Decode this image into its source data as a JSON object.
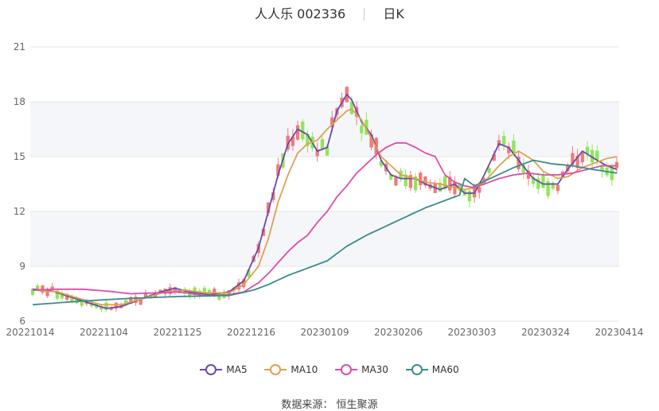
{
  "header": {
    "stock": "人人乐 002336",
    "period": "日K"
  },
  "legend": [
    {
      "name": "MA5",
      "color": "#6b4ba8"
    },
    {
      "name": "MA10",
      "color": "#e0a050"
    },
    {
      "name": "MA30",
      "color": "#d94fa8"
    },
    {
      "name": "MA60",
      "color": "#3a8c8c"
    }
  ],
  "source": "数据来源： 恒生聚源",
  "colors": {
    "up": "#f07a7a",
    "down": "#8ee65a"
  },
  "chart_data": {
    "type": "candlestick",
    "ylim": [
      6,
      21
    ],
    "yticks": [
      "6",
      "9",
      "12",
      "15",
      "18",
      "21"
    ],
    "xticks": [
      "20221014",
      "20221104",
      "20221125",
      "20221216",
      "20230109",
      "20230206",
      "20230303",
      "20230324",
      "20230414"
    ],
    "num_bars": 120,
    "series": [
      {
        "name": "MA5",
        "anchors": [
          [
            0,
            7.75
          ],
          [
            4,
            7.65
          ],
          [
            8,
            7.3
          ],
          [
            12,
            6.95
          ],
          [
            15,
            6.7
          ],
          [
            18,
            6.8
          ],
          [
            22,
            7.2
          ],
          [
            26,
            7.6
          ],
          [
            29,
            7.8
          ],
          [
            32,
            7.6
          ],
          [
            36,
            7.45
          ],
          [
            40,
            7.6
          ],
          [
            43,
            8.2
          ],
          [
            46,
            10
          ],
          [
            48,
            12
          ],
          [
            50,
            14
          ],
          [
            52,
            15.7
          ],
          [
            54,
            16.5
          ],
          [
            56,
            16.2
          ],
          [
            58,
            15.3
          ],
          [
            60,
            15.5
          ],
          [
            62,
            17.5
          ],
          [
            64,
            18.4
          ],
          [
            65,
            18.1
          ],
          [
            67,
            16.9
          ],
          [
            69,
            16.2
          ],
          [
            71,
            14.8
          ],
          [
            73,
            14
          ],
          [
            75,
            13.8
          ],
          [
            78,
            13.8
          ],
          [
            80,
            13.5
          ],
          [
            83,
            13.2
          ],
          [
            86,
            13.5
          ],
          [
            88,
            13
          ],
          [
            90,
            13
          ],
          [
            92,
            14
          ],
          [
            95,
            15.7
          ],
          [
            97,
            15.5
          ],
          [
            99,
            14.8
          ],
          [
            102,
            13.8
          ],
          [
            104,
            13.5
          ],
          [
            107,
            13.5
          ],
          [
            109,
            14.3
          ],
          [
            112,
            15.3
          ],
          [
            115,
            14.8
          ],
          [
            117,
            14.5
          ],
          [
            119,
            14.3
          ]
        ]
      },
      {
        "name": "MA10",
        "anchors": [
          [
            0,
            7.7
          ],
          [
            5,
            7.6
          ],
          [
            10,
            7.2
          ],
          [
            14,
            6.9
          ],
          [
            18,
            6.9
          ],
          [
            22,
            7.2
          ],
          [
            27,
            7.6
          ],
          [
            31,
            7.7
          ],
          [
            35,
            7.55
          ],
          [
            40,
            7.55
          ],
          [
            43,
            8.0
          ],
          [
            46,
            9
          ],
          [
            48,
            10.5
          ],
          [
            50,
            12.5
          ],
          [
            52,
            14
          ],
          [
            54,
            15.2
          ],
          [
            56,
            15.7
          ],
          [
            58,
            15.9
          ],
          [
            60,
            16.5
          ],
          [
            62,
            17
          ],
          [
            64,
            17.5
          ],
          [
            65,
            17.6
          ],
          [
            67,
            17
          ],
          [
            69,
            16
          ],
          [
            71,
            15
          ],
          [
            73,
            14.5
          ],
          [
            75,
            14
          ],
          [
            78,
            13.8
          ],
          [
            80,
            13.6
          ],
          [
            83,
            13.5
          ],
          [
            86,
            13.3
          ],
          [
            88,
            13.2
          ],
          [
            90,
            13.3
          ],
          [
            92,
            13.6
          ],
          [
            95,
            14.5
          ],
          [
            97,
            15
          ],
          [
            99,
            15.3
          ],
          [
            102,
            14.8
          ],
          [
            104,
            14.2
          ],
          [
            107,
            13.8
          ],
          [
            109,
            13.9
          ],
          [
            112,
            14.4
          ],
          [
            115,
            14.7
          ],
          [
            117,
            14.9
          ],
          [
            119,
            15
          ]
        ]
      },
      {
        "name": "MA30",
        "anchors": [
          [
            0,
            7.7
          ],
          [
            5,
            7.75
          ],
          [
            10,
            7.75
          ],
          [
            15,
            7.65
          ],
          [
            20,
            7.5
          ],
          [
            25,
            7.55
          ],
          [
            30,
            7.6
          ],
          [
            35,
            7.4
          ],
          [
            40,
            7.45
          ],
          [
            43,
            7.6
          ],
          [
            46,
            8.1
          ],
          [
            48,
            8.6
          ],
          [
            50,
            9.2
          ],
          [
            52,
            9.8
          ],
          [
            54,
            10.3
          ],
          [
            56,
            10.7
          ],
          [
            58,
            11.4
          ],
          [
            60,
            12
          ],
          [
            62,
            12.8
          ],
          [
            64,
            13.4
          ],
          [
            66,
            14.1
          ],
          [
            68,
            14.6
          ],
          [
            70,
            15.1
          ],
          [
            72,
            15.5
          ],
          [
            74,
            15.75
          ],
          [
            76,
            15.75
          ],
          [
            78,
            15.5
          ],
          [
            80,
            15.2
          ],
          [
            82,
            15
          ],
          [
            84,
            14
          ],
          [
            86,
            13.6
          ],
          [
            88,
            13.4
          ],
          [
            90,
            13.3
          ],
          [
            92,
            13.5
          ],
          [
            95,
            13.8
          ],
          [
            98,
            14
          ],
          [
            101,
            14.1
          ],
          [
            104,
            14
          ],
          [
            107,
            14
          ],
          [
            110,
            14.1
          ],
          [
            113,
            14.3
          ],
          [
            116,
            14.5
          ],
          [
            119,
            14.5
          ]
        ]
      },
      {
        "name": "MA60",
        "anchors": [
          [
            0,
            6.9
          ],
          [
            10,
            7.1
          ],
          [
            20,
            7.25
          ],
          [
            30,
            7.35
          ],
          [
            40,
            7.4
          ],
          [
            45,
            7.7
          ],
          [
            48,
            8
          ],
          [
            52,
            8.5
          ],
          [
            56,
            8.9
          ],
          [
            60,
            9.3
          ],
          [
            62,
            9.7
          ],
          [
            64,
            10.1
          ],
          [
            68,
            10.7
          ],
          [
            72,
            11.2
          ],
          [
            76,
            11.7
          ],
          [
            80,
            12.2
          ],
          [
            84,
            12.6
          ],
          [
            87,
            12.9
          ],
          [
            88,
            13.8
          ],
          [
            90,
            13.4
          ],
          [
            94,
            13.9
          ],
          [
            98,
            14.4
          ],
          [
            102,
            14.8
          ],
          [
            106,
            14.6
          ],
          [
            110,
            14.5
          ],
          [
            114,
            14.3
          ],
          [
            119,
            14.1
          ]
        ]
      }
    ]
  }
}
